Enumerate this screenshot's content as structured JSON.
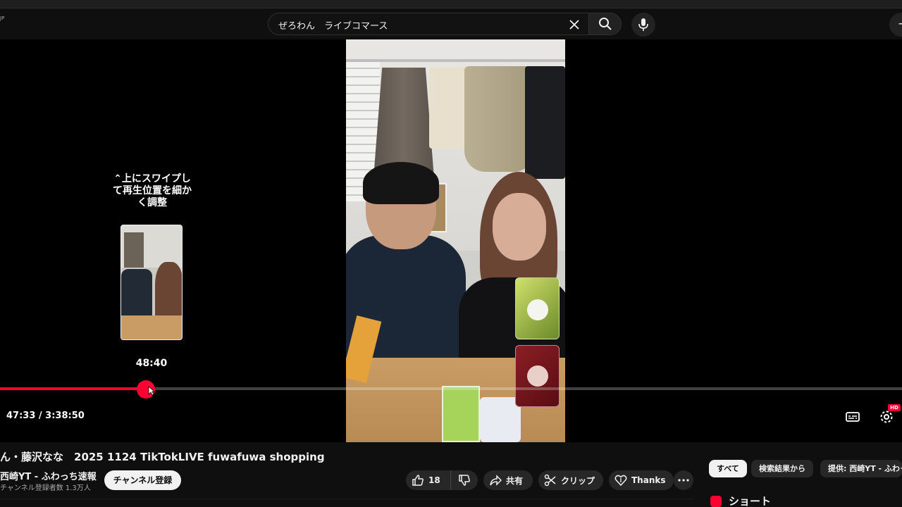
{
  "search": {
    "query": "ぜろわん　ライブコマース"
  },
  "player": {
    "seek_hint": "⌃上にスワイプして再生位置を細かく調整",
    "preview_time": "48:40",
    "time_display": "47:33 / 3:38:50",
    "progress_fraction": 0.162,
    "quality_badge": "HD",
    "accent_color": "#ff0033"
  },
  "video": {
    "title": "ん・藤沢なな　2025 1124 TikTokLIVE fuwafuwa shopping",
    "channel_name": "西崎YT - ふわっち速報",
    "subscribers": "チャンネル登録者数 1.3万人",
    "subscribe_label": "チャンネル登録"
  },
  "actions": {
    "like_count": "18",
    "share_label": "共有",
    "clip_label": "クリップ",
    "thanks_label": "Thanks"
  },
  "chips": [
    "すべて",
    "検索結果から",
    "提供: 西崎YT - ふわっち速報"
  ],
  "shorts": {
    "title": "ショート"
  }
}
